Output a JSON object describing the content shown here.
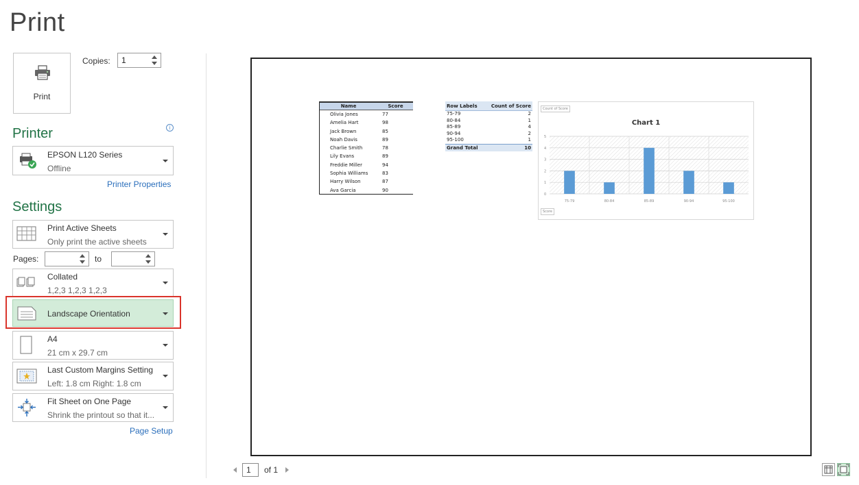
{
  "page": {
    "title": "Print"
  },
  "print_button": {
    "label": "Print",
    "icon": "printer-icon"
  },
  "copies": {
    "label": "Copies:",
    "value": "1"
  },
  "printer": {
    "heading": "Printer",
    "info_icon": "info-icon",
    "name": "EPSON L120 Series",
    "status": "Offline",
    "properties_link": "Printer Properties"
  },
  "settings": {
    "heading": "Settings",
    "items": [
      {
        "title": "Print Active Sheets",
        "subtitle": "Only print the active sheets",
        "icon": "sheets-grid-icon"
      },
      {
        "title": "Collated",
        "subtitle": "1,2,3    1,2,3    1,2,3",
        "icon": "collated-icon"
      },
      {
        "title": "Landscape Orientation",
        "subtitle": "",
        "icon": "landscape-page-icon",
        "selected": true
      },
      {
        "title": "A4",
        "subtitle": "21 cm x 29.7 cm",
        "icon": "paper-size-icon"
      },
      {
        "title": "Last Custom Margins Setting",
        "subtitle": "Left:  1.8 cm    Right:  1.8 cm",
        "icon": "margins-icon"
      },
      {
        "title": "Fit Sheet on One Page",
        "subtitle": "Shrink the printout so that it...",
        "icon": "fit-page-icon"
      }
    ],
    "pages_label": "Pages:",
    "pages_to_label": "to",
    "pages_from": "",
    "pages_to": "",
    "page_setup_link": "Page Setup"
  },
  "preview": {
    "table": {
      "headers": [
        "Name",
        "Score"
      ],
      "rows": [
        [
          "Olivia Jones",
          "77"
        ],
        [
          "Amelia Hart",
          "98"
        ],
        [
          "Jack Brown",
          "85"
        ],
        [
          "Noah Davis",
          "89"
        ],
        [
          "Charlie Smith",
          "78"
        ],
        [
          "Lily Evans",
          "89"
        ],
        [
          "Freddie  Miller",
          "94"
        ],
        [
          "Sophia Williams",
          "83"
        ],
        [
          "Harry Wilson",
          "87"
        ],
        [
          "Ava Garcia",
          "90"
        ]
      ]
    },
    "pivot": {
      "headers": [
        "Row Labels",
        "Count of Score"
      ],
      "rows": [
        [
          "75-79",
          "2"
        ],
        [
          "80-84",
          "1"
        ],
        [
          "85-89",
          "4"
        ],
        [
          "90-94",
          "2"
        ],
        [
          "95-100",
          "1"
        ]
      ],
      "total": [
        "Grand Total",
        "10"
      ]
    },
    "chart_field_top": "Count of Score",
    "chart_field_bottom": "Score"
  },
  "chart_data": {
    "type": "bar",
    "title": "Chart 1",
    "categories": [
      "75-79",
      "80-84",
      "85-89",
      "90-94",
      "95-100"
    ],
    "values": [
      2,
      1,
      4,
      2,
      1
    ],
    "ylim": [
      0,
      5
    ],
    "yticks": [
      "0",
      "1",
      "2",
      "3",
      "4",
      "5"
    ],
    "bar_color": "#5b9bd5",
    "grid": true
  },
  "pager": {
    "current": "1",
    "of_text": "of 1"
  },
  "view_buttons": [
    {
      "icon": "show-margins-icon",
      "active": false
    },
    {
      "icon": "zoom-to-page-icon",
      "active": true
    }
  ],
  "colors": {
    "accent": "#217346",
    "selected_bg": "#d3ecd9",
    "highlight": "#d9342b",
    "link": "#2a6ebb"
  }
}
